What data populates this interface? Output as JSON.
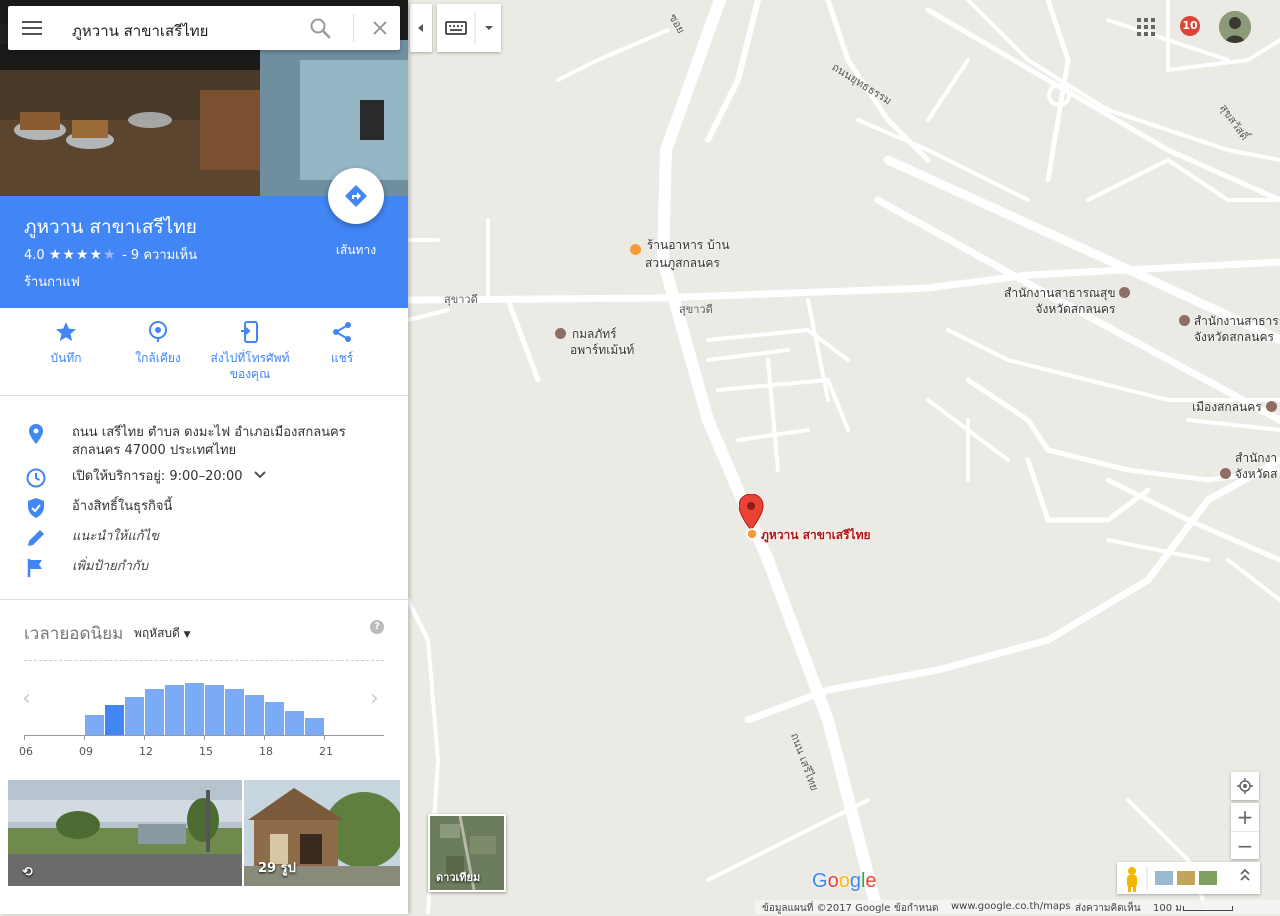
{
  "search": {
    "query": "ภูหวาน สาขาเสรีไทย"
  },
  "place": {
    "name": "ภูหวาน สาขาเสรีไทย",
    "rating": "4.0",
    "stars_filled": 4,
    "stars_total": 5,
    "reviews": "- 9 ความเห็น",
    "category": "ร้านกาแฟ",
    "directions_label": "เส้นทาง",
    "brand_color": "#4285f4"
  },
  "actions": [
    {
      "label": "บันทึก",
      "icon": "star-icon"
    },
    {
      "label": "ใกล้เคียง",
      "icon": "nearby-icon"
    },
    {
      "label": "ส่งไปที่โทรศัพท์ของคุณ",
      "line1": "ส่งไปที่โทรศัพท์",
      "line2": "ของคุณ",
      "icon": "send-to-phone-icon"
    },
    {
      "label": "แชร์",
      "icon": "share-icon"
    }
  ],
  "info": {
    "address_line1": "ถนน เสรีไทย ตำบล ดงมะไฟ อำเภอเมืองสกลนคร",
    "address_line2": "สกลนคร 47000 ประเทศไทย",
    "hours": "เปิดให้บริการอยู่:  9:00–20:00",
    "claim": "อ้างสิทธิ์ในธุรกิจนี้",
    "suggest_edit": "แนะนำให้แก้ไข",
    "add_label": "เพิ่มป้ายกำกับ"
  },
  "popular_times": {
    "title": "เวลายอดนิยม",
    "day": "พฤหัสบดี",
    "help": "?",
    "tick_labels": [
      "06",
      "09",
      "12",
      "15",
      "18",
      "21"
    ],
    "hours": [
      6,
      7,
      8,
      9,
      10,
      11,
      12,
      13,
      14,
      15,
      16,
      17,
      18,
      19,
      20,
      21,
      22,
      23
    ],
    "busyness": [
      0,
      0,
      0,
      20,
      30,
      38,
      46,
      50,
      52,
      50,
      46,
      40,
      33,
      24,
      17,
      0,
      0,
      0
    ],
    "current_hour": 10
  },
  "photos": {
    "street_view_icon": "street-view-rotate-icon",
    "count_label": "29 รูป"
  },
  "map": {
    "labels": {
      "restaurant": [
        "ร้านอาหาร บ้าน",
        "สวนภูสกลนคร"
      ],
      "apartment": [
        "กมลภัทร์",
        "อพาร์ทเม้นท์"
      ],
      "health_office_1": [
        "สำนักงานสาธารณสุข",
        "จังหวัดสกลนคร"
      ],
      "health_office_2": [
        "สำนักงานสาธารณ",
        "จังหวัดสกลนคร"
      ],
      "mueang": "เมืองสกลนคร",
      "office_3": [
        "สำนักงา",
        "จังหวัดส"
      ],
      "road_sukhawadi_1": "สุขาวดี",
      "road_sukhawadi_2": "สุขาวดี",
      "road_seri_thai": "ถนน เสรีไทย",
      "road_yuttitham": "ถนนยุทธธรรม",
      "road_sukhasawat": "สุขสวัสดิ์",
      "road_soi": "ซอย"
    },
    "pin_label": "ภูหวาน สาขาเสรีไทย",
    "satellite_label": "ดาวเทียม",
    "notifications": "10",
    "google_logo": "Google",
    "footer": {
      "map_data": "ข้อมูลแผนที่ ©2017 Google",
      "terms": "ข้อกำหนด",
      "url": "www.google.co.th/maps",
      "feedback": "ส่งความคิดเห็น",
      "scale": "100 ม."
    },
    "colors": {
      "land": "#eceae4",
      "road": "#ffffff",
      "poi_food": "#f29b38",
      "poi_civic": "#8d6e63",
      "pin": "#ea4335"
    }
  }
}
